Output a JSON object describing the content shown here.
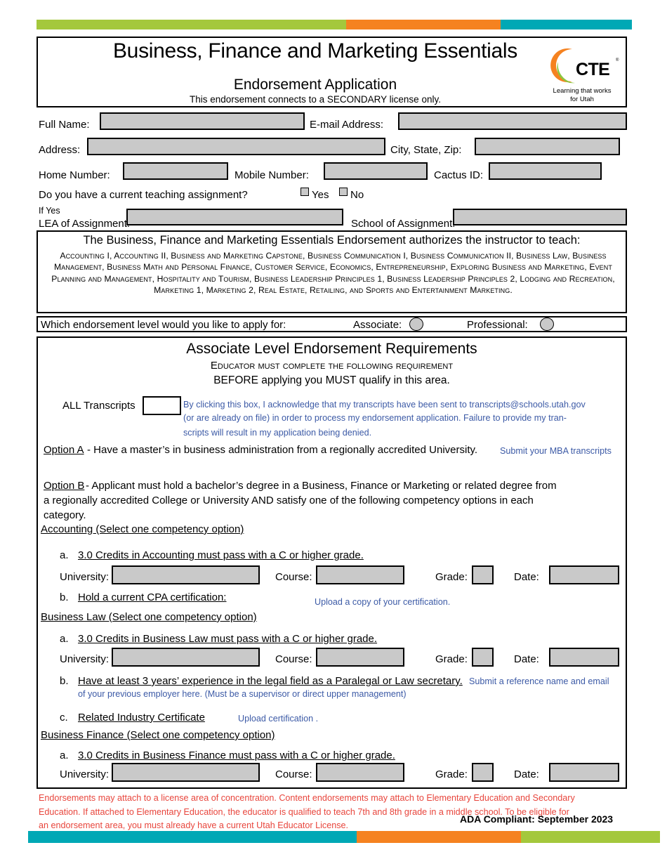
{
  "colors": {
    "green": "#a4c83c",
    "orange": "#f58220",
    "teal": "#00a8b5",
    "field_gray": "#c9c9c9",
    "blue_text": "#3c5aa6",
    "red_text": "#e8453c"
  },
  "header": {
    "title": "Business, Finance and Marketing Essentials",
    "subtitle": "Endorsement Application",
    "note": "This endorsement connects to a SECONDARY license only.",
    "logo": {
      "name": "cte-logo",
      "text": "CTE",
      "registered": "®",
      "tagline_line1": "Learning that works",
      "tagline_line2": "for Utah"
    }
  },
  "applicant": {
    "full_name_label": "Full Name:",
    "full_name_value": "",
    "email_label": "E-mail Address:",
    "email_value": "",
    "address_label": "Address:",
    "address_value": "",
    "city_state_zip_label": "City, State, Zip:",
    "city_state_zip_value": "",
    "home_number_label": "Home Number:",
    "home_number_value": "",
    "mobile_number_label": "Mobile Number:",
    "mobile_number_value": "",
    "cactus_id_label": "Cactus ID:",
    "cactus_id_value": "",
    "teaching_question": "Do you have a current teaching assignment?",
    "yes_label": "Yes",
    "no_label": "No",
    "if_yes_label": "If Yes",
    "lea_label": "LEA of Assignment:",
    "lea_value": "",
    "school_label": "School of Assignment:",
    "school_value": ""
  },
  "authorize": {
    "heading": "The Business, Finance and Marketing Essentials Endorsement authorizes the instructor to teach:",
    "courses": "Accounting I, Accounting II, Business and Marketing Capstone, Business Communication I, Business Communication II, Business Law, Business Management, Business Math and Personal Finance, Customer Service, Economics, Entrepreneurship, Exploring Business and Marketing, Event Planning and Management, Hospitality and Tourism, Business Leadership Principles 1, Business Leadership Principles 2, Lodging and Recreation, Marketing 1, Marketing 2, Real Estate, Retailing, and Sports and Entertainment Marketing."
  },
  "level": {
    "question": "Which endorsement level would you like to apply for:",
    "associate_label": "Associate:",
    "professional_label": "Professional:"
  },
  "requirements": {
    "title": "Associate Level Endorsement Requirements",
    "subtitle1": "Educator must complete the following requirement",
    "subtitle2": "BEFORE applying you MUST qualify in this area.",
    "transcripts_label": "ALL Transcripts",
    "transcripts_note_line1": "By clicking this box, I acknowledge that my transcripts have been sent to transcripts@schools.utah.gov",
    "transcripts_note_line2": "(or are already on file) in order to process my endorsement application. Failure to provide my tran-",
    "transcripts_note_line3": "scripts will result in my application being denied.",
    "option_a_label": "Option A",
    "option_a_text": "- Have a master’s in business administration from a regionally accredited University.",
    "option_a_blue": "Submit your MBA transcripts",
    "option_b_label": "Option B",
    "option_b_line1": "- Applicant must hold a bachelor’s degree in a Business, Finance or Marketing or related degree from",
    "option_b_line2": "a regionally accredited College or University AND satisfy one of the following competency options in each",
    "option_b_line3": "category.",
    "field_labels": {
      "university": "University:",
      "course": "Course:",
      "grade": "Grade:",
      "date": "Date:"
    },
    "categories": [
      {
        "name": "Accounting (Select one competency option)",
        "items": [
          {
            "marker": "a.",
            "text": "3.0 Credits in Accounting must pass with a C or higher grade.",
            "has_fields": true,
            "university_value": "",
            "course_value": "",
            "grade_value": "",
            "date_value": ""
          },
          {
            "marker": "b.",
            "text": "Hold a current CPA certification:",
            "blue_note": "Upload a copy of your certification.",
            "has_fields": false
          }
        ]
      },
      {
        "name": "Business Law  (Select one competency option)",
        "items": [
          {
            "marker": "a.",
            "text": "3.0 Credits in Business Law must pass with a C or higher grade.",
            "has_fields": true,
            "university_value": "",
            "course_value": "",
            "grade_value": "",
            "date_value": ""
          },
          {
            "marker": "b.",
            "text": "Have at least 3 years’ experience in the legal field as a Paralegal or Law secretary.",
            "blue_note": "Submit a reference name and email",
            "blue_note_line2": "of your previous employer here. (Must be a supervisor or direct upper management)",
            "has_fields": false
          },
          {
            "marker": "c.",
            "text": "Related Industry Certificate",
            "blue_note": "Upload certification .",
            "has_fields": false
          }
        ]
      },
      {
        "name": "Business Finance (Select one competency option)",
        "items": [
          {
            "marker": "a.",
            "text": "3.0 Credits in Business Finance must pass with a C or higher grade.",
            "has_fields": true,
            "university_value": "",
            "course_value": "",
            "grade_value": "",
            "date_value": ""
          }
        ]
      }
    ]
  },
  "footer": {
    "disclaimer_line1": "Endorsements may attach to a license area of concentration. Content endorsements may attach to Elementary Education and Secondary",
    "disclaimer_line2": "Education. If attached to Elementary Education,  the educator is qualified to teach 7th and 8th grade in a middle school. To be eligible for",
    "disclaimer_line3": "an endorsement area, you must already have a current Utah Educator License.",
    "ada": "ADA  Compliant: September 2023"
  }
}
